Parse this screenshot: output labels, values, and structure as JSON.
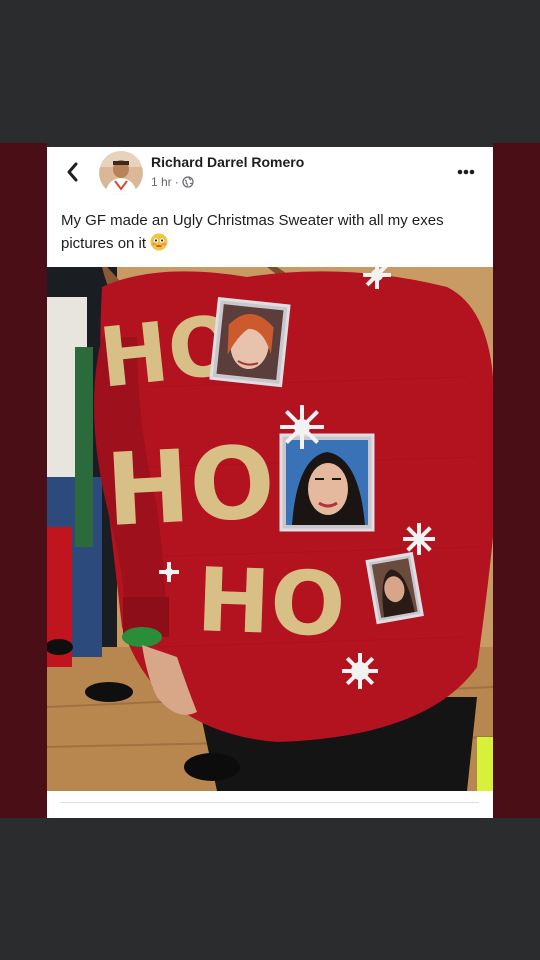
{
  "post": {
    "author": "Richard Darrel Romero",
    "time": "1 hr",
    "separator": "·",
    "privacy_icon": "globe-icon",
    "caption": "My GF made an Ugly Christmas Sweater with all my exes pictures on it",
    "caption_emoji": "flushed-face-emoji",
    "back_icon": "chevron-left-icon",
    "more_icon": "more-dots-icon"
  },
  "photo": {
    "sweater_text": [
      "HO",
      "HO",
      "HO"
    ],
    "embedded_photos": 3
  },
  "colors": {
    "sweater": "#b3121f",
    "gold_letters": "#d7bf86",
    "background_dark": "#2b2c2e",
    "frame_dark_red": "#4a0f16"
  }
}
